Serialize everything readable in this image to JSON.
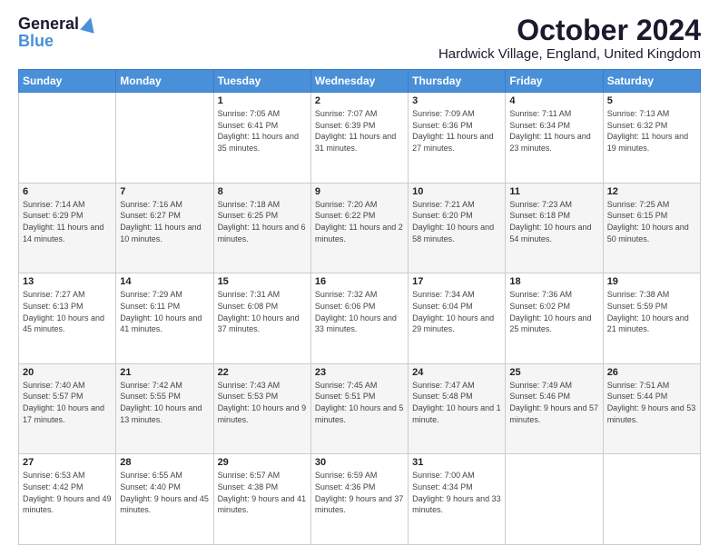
{
  "logo": {
    "line1": "General",
    "line2": "Blue"
  },
  "title": "October 2024",
  "subtitle": "Hardwick Village, England, United Kingdom",
  "days_of_week": [
    "Sunday",
    "Monday",
    "Tuesday",
    "Wednesday",
    "Thursday",
    "Friday",
    "Saturday"
  ],
  "weeks": [
    [
      {
        "day": "",
        "info": ""
      },
      {
        "day": "",
        "info": ""
      },
      {
        "day": "1",
        "info": "Sunrise: 7:05 AM\nSunset: 6:41 PM\nDaylight: 11 hours and 35 minutes."
      },
      {
        "day": "2",
        "info": "Sunrise: 7:07 AM\nSunset: 6:39 PM\nDaylight: 11 hours and 31 minutes."
      },
      {
        "day": "3",
        "info": "Sunrise: 7:09 AM\nSunset: 6:36 PM\nDaylight: 11 hours and 27 minutes."
      },
      {
        "day": "4",
        "info": "Sunrise: 7:11 AM\nSunset: 6:34 PM\nDaylight: 11 hours and 23 minutes."
      },
      {
        "day": "5",
        "info": "Sunrise: 7:13 AM\nSunset: 6:32 PM\nDaylight: 11 hours and 19 minutes."
      }
    ],
    [
      {
        "day": "6",
        "info": "Sunrise: 7:14 AM\nSunset: 6:29 PM\nDaylight: 11 hours and 14 minutes."
      },
      {
        "day": "7",
        "info": "Sunrise: 7:16 AM\nSunset: 6:27 PM\nDaylight: 11 hours and 10 minutes."
      },
      {
        "day": "8",
        "info": "Sunrise: 7:18 AM\nSunset: 6:25 PM\nDaylight: 11 hours and 6 minutes."
      },
      {
        "day": "9",
        "info": "Sunrise: 7:20 AM\nSunset: 6:22 PM\nDaylight: 11 hours and 2 minutes."
      },
      {
        "day": "10",
        "info": "Sunrise: 7:21 AM\nSunset: 6:20 PM\nDaylight: 10 hours and 58 minutes."
      },
      {
        "day": "11",
        "info": "Sunrise: 7:23 AM\nSunset: 6:18 PM\nDaylight: 10 hours and 54 minutes."
      },
      {
        "day": "12",
        "info": "Sunrise: 7:25 AM\nSunset: 6:15 PM\nDaylight: 10 hours and 50 minutes."
      }
    ],
    [
      {
        "day": "13",
        "info": "Sunrise: 7:27 AM\nSunset: 6:13 PM\nDaylight: 10 hours and 45 minutes."
      },
      {
        "day": "14",
        "info": "Sunrise: 7:29 AM\nSunset: 6:11 PM\nDaylight: 10 hours and 41 minutes."
      },
      {
        "day": "15",
        "info": "Sunrise: 7:31 AM\nSunset: 6:08 PM\nDaylight: 10 hours and 37 minutes."
      },
      {
        "day": "16",
        "info": "Sunrise: 7:32 AM\nSunset: 6:06 PM\nDaylight: 10 hours and 33 minutes."
      },
      {
        "day": "17",
        "info": "Sunrise: 7:34 AM\nSunset: 6:04 PM\nDaylight: 10 hours and 29 minutes."
      },
      {
        "day": "18",
        "info": "Sunrise: 7:36 AM\nSunset: 6:02 PM\nDaylight: 10 hours and 25 minutes."
      },
      {
        "day": "19",
        "info": "Sunrise: 7:38 AM\nSunset: 5:59 PM\nDaylight: 10 hours and 21 minutes."
      }
    ],
    [
      {
        "day": "20",
        "info": "Sunrise: 7:40 AM\nSunset: 5:57 PM\nDaylight: 10 hours and 17 minutes."
      },
      {
        "day": "21",
        "info": "Sunrise: 7:42 AM\nSunset: 5:55 PM\nDaylight: 10 hours and 13 minutes."
      },
      {
        "day": "22",
        "info": "Sunrise: 7:43 AM\nSunset: 5:53 PM\nDaylight: 10 hours and 9 minutes."
      },
      {
        "day": "23",
        "info": "Sunrise: 7:45 AM\nSunset: 5:51 PM\nDaylight: 10 hours and 5 minutes."
      },
      {
        "day": "24",
        "info": "Sunrise: 7:47 AM\nSunset: 5:48 PM\nDaylight: 10 hours and 1 minute."
      },
      {
        "day": "25",
        "info": "Sunrise: 7:49 AM\nSunset: 5:46 PM\nDaylight: 9 hours and 57 minutes."
      },
      {
        "day": "26",
        "info": "Sunrise: 7:51 AM\nSunset: 5:44 PM\nDaylight: 9 hours and 53 minutes."
      }
    ],
    [
      {
        "day": "27",
        "info": "Sunrise: 6:53 AM\nSunset: 4:42 PM\nDaylight: 9 hours and 49 minutes."
      },
      {
        "day": "28",
        "info": "Sunrise: 6:55 AM\nSunset: 4:40 PM\nDaylight: 9 hours and 45 minutes."
      },
      {
        "day": "29",
        "info": "Sunrise: 6:57 AM\nSunset: 4:38 PM\nDaylight: 9 hours and 41 minutes."
      },
      {
        "day": "30",
        "info": "Sunrise: 6:59 AM\nSunset: 4:36 PM\nDaylight: 9 hours and 37 minutes."
      },
      {
        "day": "31",
        "info": "Sunrise: 7:00 AM\nSunset: 4:34 PM\nDaylight: 9 hours and 33 minutes."
      },
      {
        "day": "",
        "info": ""
      },
      {
        "day": "",
        "info": ""
      }
    ]
  ]
}
